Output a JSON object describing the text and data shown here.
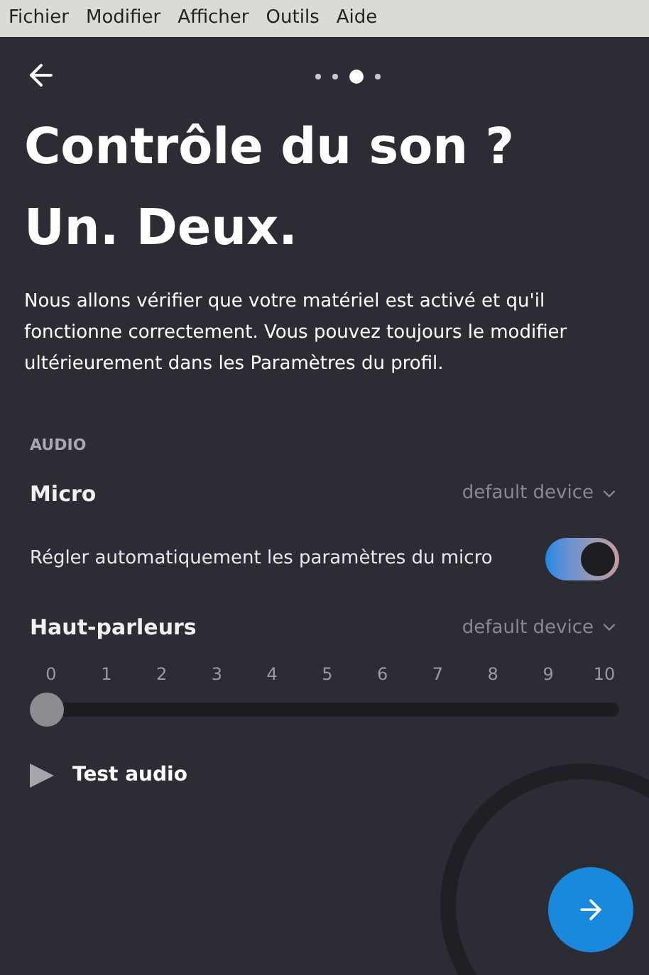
{
  "menu_bar": [
    "Fichier",
    "Modifier",
    "Afficher",
    "Outils",
    "Aide"
  ],
  "pager": [
    {
      "selected": false
    },
    {
      "selected": false
    },
    {
      "selected": true
    },
    {
      "selected": false
    }
  ],
  "title": "Contrôle du son ? Un. Deux.",
  "description": "Nous allons vérifier que votre matériel est activé et qu'il fonctionne correctement. Vous pouvez toujours le modifier ultérieurement dans les Paramètres du profil.",
  "section": "AUDIO",
  "microphone": {
    "label": "Micro",
    "device": "default device"
  },
  "auto_adjust": {
    "label": "Régler automatiquement les paramètres du micro",
    "on": true
  },
  "speakers": {
    "label": "Haut-parleurs",
    "device": "default device",
    "ticks": [
      "0",
      "1",
      "2",
      "3",
      "4",
      "5",
      "6",
      "7",
      "8",
      "9",
      "10"
    ],
    "level": 0
  },
  "test_audio": "Test audio"
}
